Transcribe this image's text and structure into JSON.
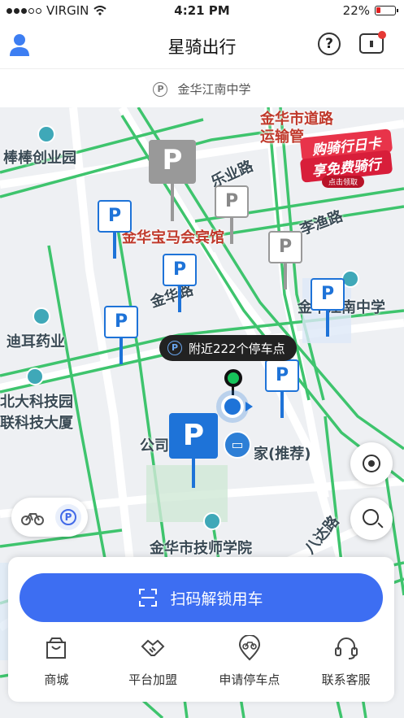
{
  "status_bar": {
    "carrier": "VIRGIN",
    "time": "4:21 PM",
    "battery": "22%"
  },
  "header": {
    "title": "星骑出行",
    "help_icon": "question-circle-icon",
    "message_icon": "message-box-icon",
    "user_icon": "user-avatar-icon"
  },
  "location": {
    "name": "金华江南中学",
    "icon": "parking-circle-icon"
  },
  "map": {
    "pois": [
      "棒棒创业园",
      "金华市道路",
      "运输管",
      "乐业路",
      "金华宝马会宾馆",
      "李渔路",
      "金华江南中学",
      "金华路",
      "迪耳药业",
      "北大科技园",
      "联科技大厦",
      "公司",
      "家(推荐)",
      "金华市技师学院",
      "八达路"
    ],
    "promo": {
      "line1": "购骑行日卡",
      "line2": "享免费骑行",
      "line3": "点击领取"
    },
    "nearby_text": "附近222个停车点",
    "parking_sign_letter": "P"
  },
  "controls": {
    "locate_icon": "locate-target-icon",
    "search_icon": "search-icon",
    "bike_icon": "bike-icon",
    "parking_icon": "parking-circle-icon"
  },
  "panel": {
    "scan_button": "扫码解锁用车",
    "menu": [
      {
        "label": "商城",
        "icon": "shopping-bag-icon"
      },
      {
        "label": "平台加盟",
        "icon": "handshake-icon"
      },
      {
        "label": "申请停车点",
        "icon": "bike-location-icon"
      },
      {
        "label": "联系客服",
        "icon": "headset-icon"
      }
    ]
  },
  "colors": {
    "primary": "#3d6ef2",
    "parking_blue": "#1e73d8",
    "road_green": "#3ec46d",
    "pin_green": "#16c45a",
    "badge_red": "#e53935"
  }
}
